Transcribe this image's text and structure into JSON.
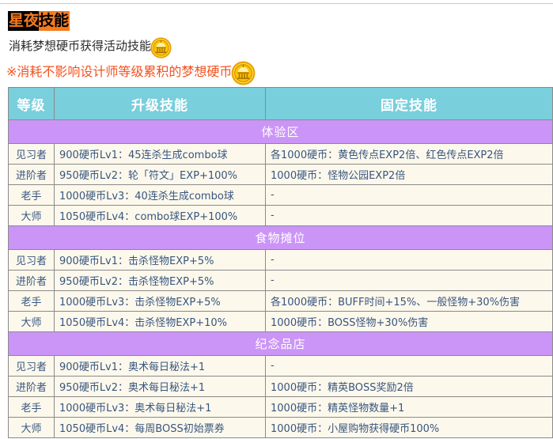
{
  "title": {
    "segment_a": "星夜",
    "segment_b": "技能"
  },
  "intro": {
    "line1": "消耗梦想硬币获得活动技能",
    "line2": "※消耗不影响设计师等级累积的梦想硬币",
    "coin_icon": "dream-coin-icon"
  },
  "colors": {
    "title_bg_dark": "#000000",
    "title_accent": "#f47b20",
    "note_text": "#f4511e",
    "header_bg": "#79cfdc",
    "section_bg": "#cb95f7",
    "cell_bg": "#fdf8ec",
    "cell_text": "#36567f",
    "border": "#8a8a8a",
    "coin_gold": "#ffc91d"
  },
  "table": {
    "headers": [
      "等级",
      "升级技能",
      "固定技能"
    ],
    "sections": [
      {
        "name": "体验区",
        "rows": [
          {
            "rank": "见习者",
            "upgrade": "900硬币Lv1：45连杀生成combo球",
            "fixed": "各1000硬币：黄色传点EXP2倍、红色传点EXP2倍"
          },
          {
            "rank": "进阶者",
            "upgrade": "950硬币Lv2：轮「符文」EXP+100%",
            "fixed": "1000硬币：怪物公园EXP2倍"
          },
          {
            "rank": "老手",
            "upgrade": "1000硬币Lv3：40连杀生成combo球",
            "fixed": "-"
          },
          {
            "rank": "大师",
            "upgrade": "1050硬币Lv4：combo球EXP+100%",
            "fixed": "-"
          }
        ]
      },
      {
        "name": "食物摊位",
        "rows": [
          {
            "rank": "见习者",
            "upgrade": "900硬币Lv1：击杀怪物EXP+5%",
            "fixed": "-"
          },
          {
            "rank": "进阶者",
            "upgrade": "950硬币Lv2：击杀怪物EXP+5%",
            "fixed": "-"
          },
          {
            "rank": "老手",
            "upgrade": "1000硬币Lv3：击杀怪物EXP+5%",
            "fixed": "各1000硬币：BUFF时间+15%、一般怪物+30%伤害"
          },
          {
            "rank": "大师",
            "upgrade": "1050硬币Lv4：击杀怪物EXP+10%",
            "fixed": "1000硬币：BOSS怪物+30%伤害"
          }
        ]
      },
      {
        "name": "纪念品店",
        "rows": [
          {
            "rank": "见习者",
            "upgrade": "900硬币Lv1：奥术每日秘法+1",
            "fixed": "-"
          },
          {
            "rank": "进阶者",
            "upgrade": "950硬币Lv2：奥术每日秘法+1",
            "fixed": "1000硬币：精英BOSS奖励2倍"
          },
          {
            "rank": "老手",
            "upgrade": "1000硬币Lv3：奥术每日秘法+1",
            "fixed": "1000硬币：精英怪物数量+1"
          },
          {
            "rank": "大师",
            "upgrade": "1050硬币Lv4：每周BOSS初始票券",
            "fixed": "1000硬币：小屋购物获得硬币100%"
          }
        ]
      }
    ]
  }
}
